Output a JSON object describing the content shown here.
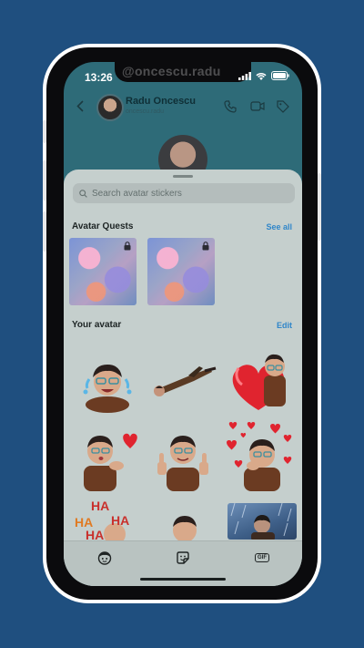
{
  "status_bar": {
    "time": "13:26",
    "watermark": "@oncescu.radu"
  },
  "chat_header": {
    "contact_name": "Radu Oncescu",
    "contact_subtitle": "oncescu.radu"
  },
  "sticker_sheet": {
    "search": {
      "placeholder": "Search avatar stickers"
    },
    "quests_section": {
      "title": "Avatar Quests",
      "action_label": "See all"
    },
    "avatar_section": {
      "title": "Your avatar",
      "action_label": "Edit"
    },
    "stickers": [
      {
        "name": "sticker-crying-laughing"
      },
      {
        "name": "sticker-flying"
      },
      {
        "name": "sticker-heart-hug"
      },
      {
        "name": "sticker-blowing-kiss"
      },
      {
        "name": "sticker-thumbs-up"
      },
      {
        "name": "sticker-hearts-around"
      },
      {
        "name": "sticker-ha-ha",
        "text": [
          "HA",
          "HA",
          "HA",
          "HA"
        ]
      },
      {
        "name": "sticker-waving"
      },
      {
        "name": "sticker-rain"
      }
    ]
  },
  "tabs": [
    {
      "icon": "avatar-icon"
    },
    {
      "icon": "sticker-icon"
    },
    {
      "label": "GIF"
    }
  ],
  "colors": {
    "background": "#1f4f7f",
    "sheet": "#c5cfcd",
    "link": "#2f86c9",
    "heart": "#e0242f"
  }
}
